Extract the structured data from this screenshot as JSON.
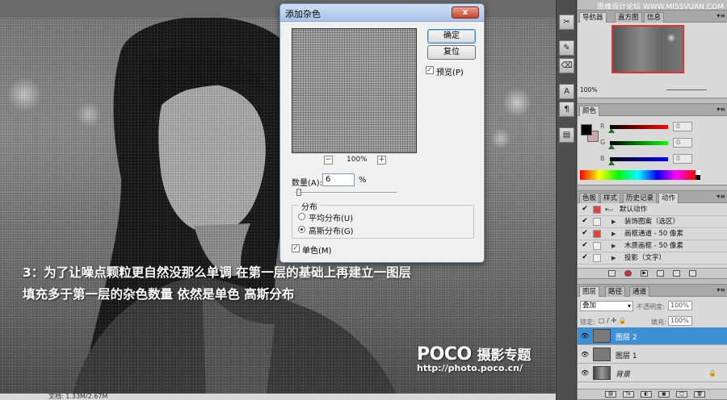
{
  "app": {
    "watermark_site": "思缘设计论坛 WWW.MISSVUAN.COM"
  },
  "canvas": {
    "caption_line1": "3：为了让噪点颗粒更自然没那么单调 在第一层的基础上再建立一图层",
    "caption_line2": "填充多于第一层的杂色数量 依然是单色 高斯分布",
    "watermark_logo": "POCO",
    "watermark_logo_suffix": "摄影专题",
    "watermark_url": "http://photo.poco.cn/",
    "status_text": "文档: 1.33M/2.67M"
  },
  "dialog": {
    "title": "添加杂色",
    "close_label": "x",
    "ok_label": "确定",
    "reset_label": "复位",
    "preview_label": "预览(P)",
    "preview_checked": true,
    "zoom_minus": "−",
    "zoom_plus": "+",
    "zoom_value": "100%",
    "amount_label": "数量(A):",
    "amount_value": "6",
    "amount_unit": "%",
    "amount_percent": 6,
    "distribution_legend": "分布",
    "dist_uniform": "平均分布(U)",
    "dist_gaussian": "高斯分布(G)",
    "dist_selected": "gaussian",
    "mono_label": "单色(M)",
    "mono_checked": true
  },
  "tools": [
    "✂",
    "✎",
    "⌫",
    "A",
    "¶",
    "▤"
  ],
  "navigator": {
    "tabs": [
      "导航器",
      "直方图",
      "信息"
    ],
    "zoom": "100%"
  },
  "color": {
    "tabs": [
      "颜色"
    ],
    "foreground": "#000000",
    "background": "#c8a8ac",
    "channels": [
      {
        "name": "R",
        "value": "0",
        "gradient": "linear-gradient(90deg,#000,#f00)"
      },
      {
        "name": "G",
        "value": "0",
        "gradient": "linear-gradient(90deg,#000,#0f0)"
      },
      {
        "name": "B",
        "value": "0",
        "gradient": "linear-gradient(90deg,#000,#00f)"
      }
    ]
  },
  "actions": {
    "tabs": [
      "色板",
      "样式",
      "历史记录",
      "动作"
    ],
    "rows": [
      {
        "text": "默认动作",
        "indent": 0,
        "folder": true,
        "red": true
      },
      {
        "text": "装饰图案（选区）",
        "indent": 1,
        "folder": false,
        "red": false
      },
      {
        "text": "画框通道 - 50 像素",
        "indent": 1,
        "folder": false,
        "red": true
      },
      {
        "text": "木质画框 - 50 像素",
        "indent": 1,
        "folder": false,
        "red": false
      },
      {
        "text": "投影（文字）",
        "indent": 1,
        "folder": false,
        "red": false
      }
    ]
  },
  "layers": {
    "tabs": [
      "图层",
      "路径",
      "通道"
    ],
    "blend_mode": "叠加",
    "opacity_label": "不透明度:",
    "opacity_value": "100%",
    "lock_label": "锁定:",
    "fill_label": "填充:",
    "fill_value": "100%",
    "items": [
      {
        "name": "图层 2",
        "selected": true,
        "locked": false
      },
      {
        "name": "图层 1",
        "selected": false,
        "locked": false
      },
      {
        "name": "背景",
        "selected": false,
        "locked": true
      }
    ],
    "footer_icons": [
      "⛓",
      "fx",
      "◐",
      "▣",
      "□",
      "🗑"
    ]
  },
  "colors": {
    "selection_blue": "#3e8fd4",
    "dialog_close_red": "#c9432b"
  }
}
